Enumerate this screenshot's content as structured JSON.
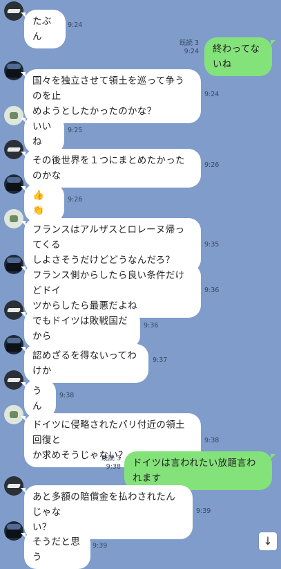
{
  "messages": [
    {
      "text": "たぶん",
      "time": "9:24"
    },
    {
      "text": "終わってないね",
      "time": "9:24",
      "read": "既読 3"
    },
    {
      "text": "国々を独立させて領土を巡って争うのを止\nめようとしたかったのかな？",
      "time": "9:24"
    },
    {
      "text": "いいね",
      "time": "9:25"
    },
    {
      "text": "その後世界を１つにまとめたかったのかな",
      "time": "9:26"
    },
    {
      "text": "👍👏",
      "time": "9:26"
    },
    {
      "text": "フランスはアルザスとロレーヌ帰ってくる\nしよさそうだけどどうなんだろ？",
      "time": "9:35"
    },
    {
      "text": "フランス側からしたら良い条件だけどドイ\nツからしたら最悪だよね",
      "time": "9:36"
    },
    {
      "text": "でもドイツは敗戦国だから",
      "time": "9:36"
    },
    {
      "text": "認めざるを得ないってわけか",
      "time": "9:37"
    },
    {
      "text": "うん",
      "time": "9:38"
    },
    {
      "text": "ドイツに侵略されたパリ付近の領土回復と\nか求めそうじゃない？",
      "time": "9:38"
    },
    {
      "text": "ドイツは言われたい放題言われます",
      "time": "9:38",
      "read": "既読 3"
    },
    {
      "text": "あと多額の賠償金を払わされたんじゃな\nい？",
      "time": "9:39"
    },
    {
      "text": "そうだと思う",
      "time": "9:39"
    }
  ],
  "scroll_button": {
    "icon": "arrow-down-icon",
    "glyph": "↓"
  }
}
